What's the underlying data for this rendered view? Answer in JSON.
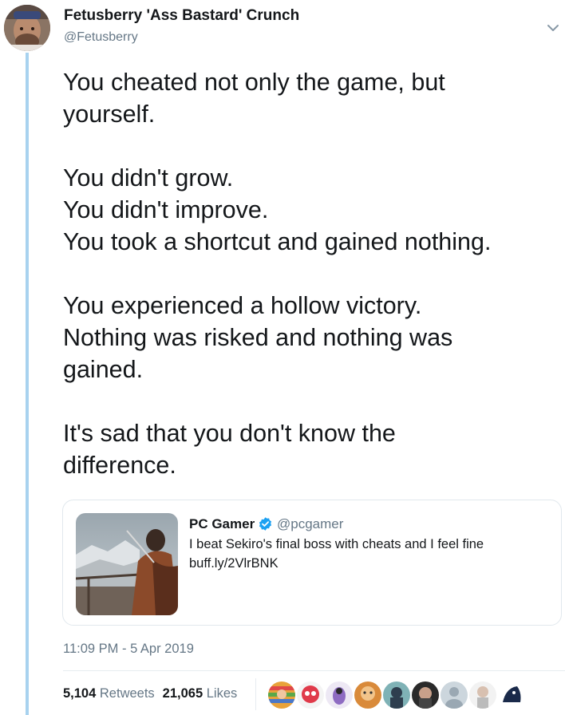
{
  "author": {
    "display_name": "Fetusberry 'Ass Bastard' Crunch",
    "handle": "@Fetusberry"
  },
  "tweet": {
    "paragraphs": [
      "You cheated not only the game, but\nyourself.",
      "You didn't grow.\nYou didn't improve.\nYou took a shortcut and gained nothing.",
      "You experienced a hollow victory.\nNothing was risked and nothing was\ngained.",
      "It's sad that you don't know the\ndifference."
    ],
    "timestamp": "11:09 PM - 5 Apr 2019"
  },
  "quoted_tweet": {
    "display_name": "PC Gamer",
    "handle": "@pcgamer",
    "text": "I beat Sekiro's final boss with cheats and I feel fine",
    "link": "buff.ly/2VlrBNK",
    "verified": true
  },
  "stats": {
    "retweets_count": "5,104",
    "retweets_label": "Retweets",
    "likes_count": "21,065",
    "likes_label": "Likes"
  },
  "icons": {
    "caret": "chevron-down-icon",
    "verified": "verified-badge-icon"
  },
  "colors": {
    "thread_line": "#a8d2ef",
    "verified": "#1da1f2",
    "secondary_text": "#657786",
    "primary_text": "#14171a"
  }
}
